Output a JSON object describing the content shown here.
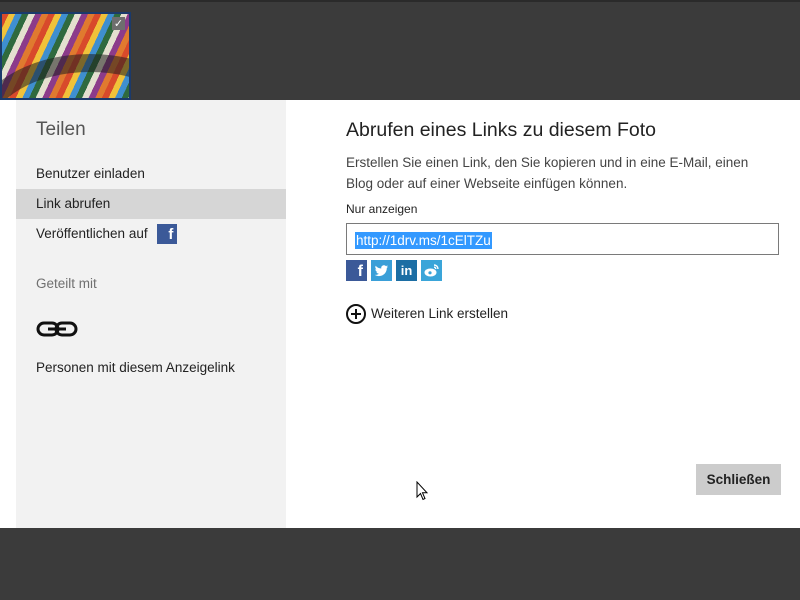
{
  "sidebar": {
    "title": "Teilen",
    "items": [
      {
        "label": "Benutzer einladen"
      },
      {
        "label": "Link abrufen"
      },
      {
        "label": "Veröffentlichen auf"
      }
    ],
    "facebook_glyph": "f",
    "shared_with_label": "Geteilt mit",
    "link_icon": "chain-link-icon",
    "people_label": "Personen mit diesem Anzeigelink"
  },
  "main": {
    "title": "Abrufen eines Links zu diesem Foto",
    "description": "Erstellen Sie einen Link, den Sie kopieren und in eine E-Mail, einen Blog oder auf einer Webseite einfügen können.",
    "field_label": "Nur anzeigen",
    "url_value": "http://1drv.ms/1cElTZu",
    "social_icons": [
      "facebook-icon",
      "twitter-icon",
      "linkedin-icon",
      "weibo-icon"
    ],
    "add_link_label": "Weiteren Link erstellen",
    "close_label": "Schließen"
  },
  "colors": {
    "selection": "#3399ff",
    "facebook": "#3b5998",
    "twitter": "#3a9fd8",
    "linkedin": "#1c6ea4"
  }
}
